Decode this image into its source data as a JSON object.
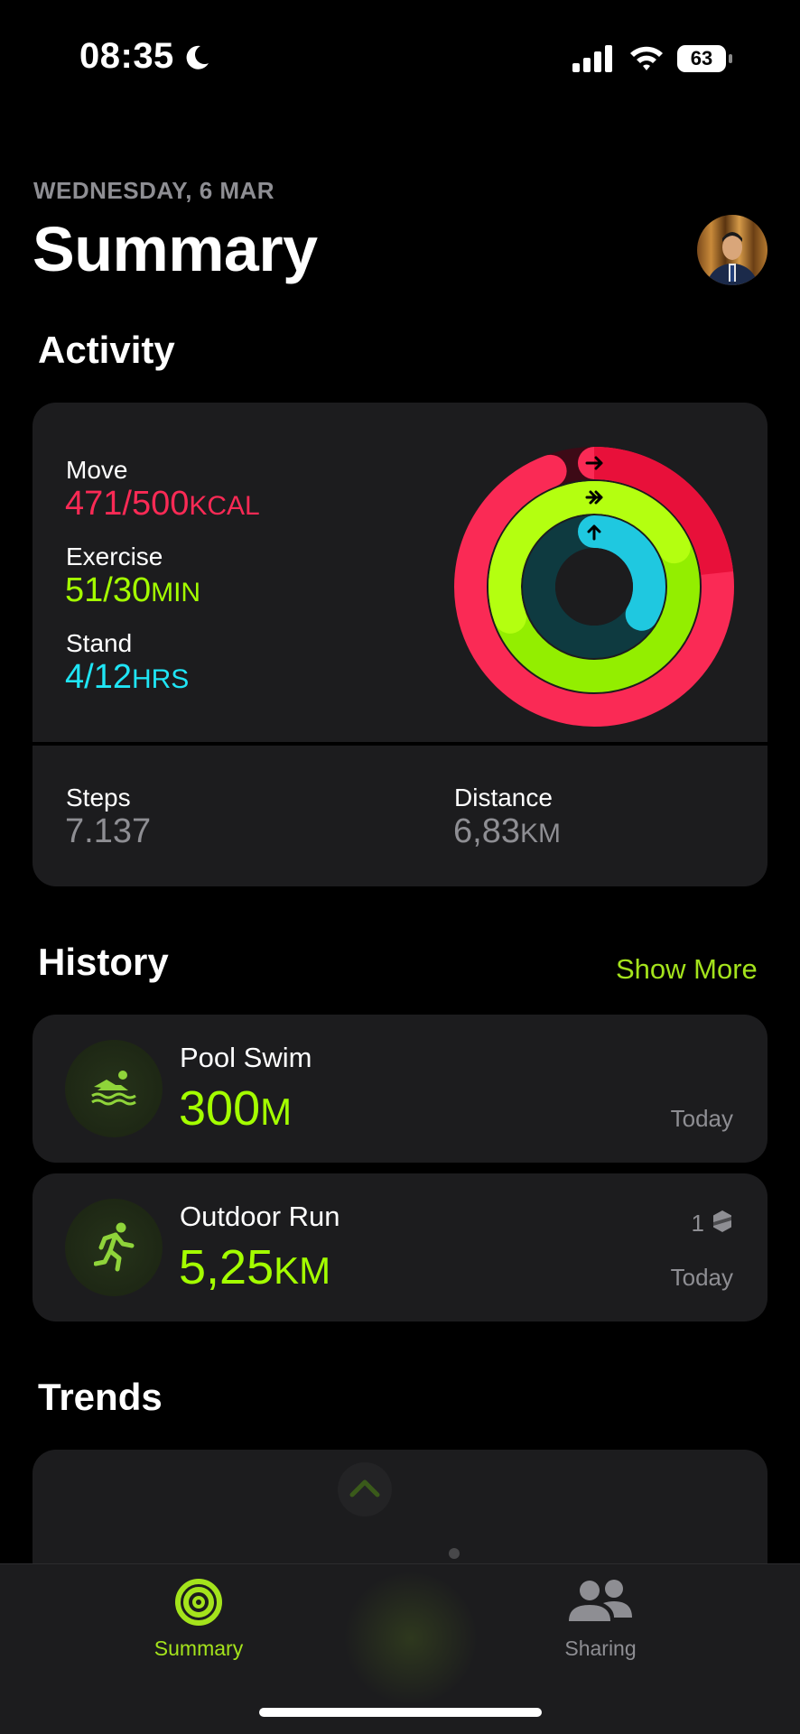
{
  "status_bar": {
    "time": "08:35",
    "battery": "63"
  },
  "header": {
    "date": "WEDNESDAY, 6 MAR",
    "title": "Summary"
  },
  "activity": {
    "section_title": "Activity",
    "move": {
      "label": "Move",
      "value": "471/500",
      "unit": "KCAL",
      "progress": 0.942,
      "color": "#fa2a55"
    },
    "exercise": {
      "label": "Exercise",
      "value": "51/30",
      "unit": "MIN",
      "progress": 1.7,
      "color": "#a4ff00"
    },
    "stand": {
      "label": "Stand",
      "value": "4/12",
      "unit": "HRS",
      "progress": 0.333,
      "color": "#1fe5f5"
    },
    "steps": {
      "label": "Steps",
      "value": "7.137"
    },
    "distance": {
      "label": "Distance",
      "value": "6,83",
      "unit": "KM"
    }
  },
  "history": {
    "section_title": "History",
    "show_more": "Show More",
    "items": [
      {
        "name": "Pool Swim",
        "value": "300",
        "unit": "M",
        "when": "Today",
        "icon": "swim-icon"
      },
      {
        "name": "Outdoor Run",
        "value": "5,25",
        "unit": "KM",
        "when": "Today",
        "badge": "1",
        "icon": "run-icon"
      }
    ]
  },
  "trends": {
    "section_title": "Trends"
  },
  "tabs": [
    {
      "label": "Summary",
      "active": true,
      "color": "#a4e31c"
    },
    {
      "label": "Sharing",
      "active": false,
      "color": "#8e8e93"
    }
  ]
}
